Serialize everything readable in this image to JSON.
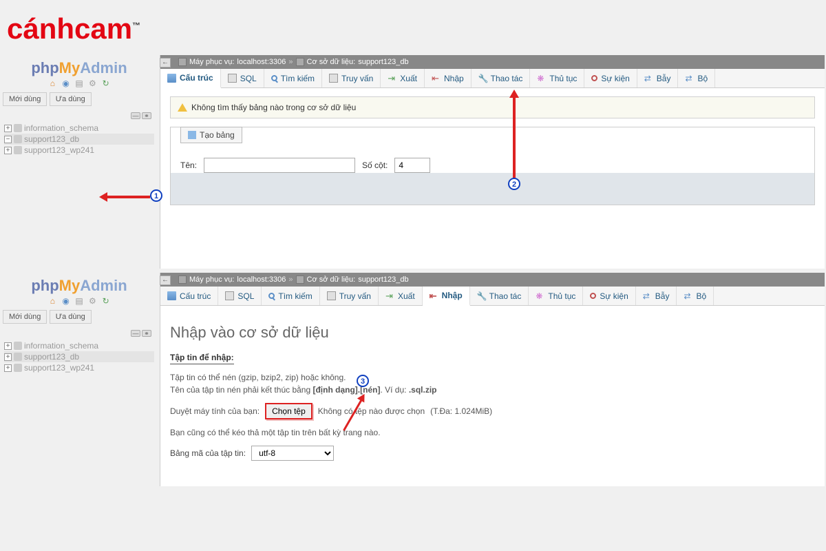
{
  "brand": "cánhcam",
  "pma_logo": {
    "php": "php",
    "my": "My",
    "admin": "Admin"
  },
  "sidebar": {
    "recent_btn": "Mới dùng",
    "fav_btn": "Ưa dùng",
    "dbs": [
      "information_schema",
      "support123_db",
      "support123_wp241"
    ]
  },
  "breadcrumb": {
    "server_prefix": "Máy phục vụ:",
    "server": "localhost:3306",
    "db_prefix": "Cơ sở dữ liệu:",
    "db": "support123_db"
  },
  "tabs": [
    "Cấu trúc",
    "SQL",
    "Tìm kiếm",
    "Truy vấn",
    "Xuất",
    "Nhập",
    "Thao tác",
    "Thủ tục",
    "Sự kiện",
    "Bẫy",
    "Bộ"
  ],
  "panel1": {
    "notice": "Không tìm thấy bảng nào trong cơ sở dữ liệu",
    "create_btn": "Tạo bảng",
    "name_label": "Tên:",
    "cols_label": "Số cột:",
    "cols_value": "4"
  },
  "panel2": {
    "title": "Nhập vào cơ sở dữ liệu",
    "section": "Tập tin để nhập:",
    "line1": "Tập tin có thể nén (gzip, bzip2, zip) hoặc không.",
    "line2a": "Tên của tập tin nén phải kết thúc bằng ",
    "line2b": "[định dạng].[nén]",
    "line2c": ". Ví dụ: ",
    "line2d": ".sql.zip",
    "browse_label": "Duyệt máy tính của bạn:",
    "file_btn": "Chọn tệp",
    "no_file": "Không có tệp nào được chọn",
    "max": "(T.Đa: 1.024MiB)",
    "drag_hint": "Bạn cũng có thể kéo thả một tập tin trên bất kỳ trang nào.",
    "charset_label": "Bảng mã của tập tin:",
    "charset_value": "utf-8"
  },
  "annotations": {
    "b1": "1",
    "b2": "2",
    "b3": "3"
  }
}
